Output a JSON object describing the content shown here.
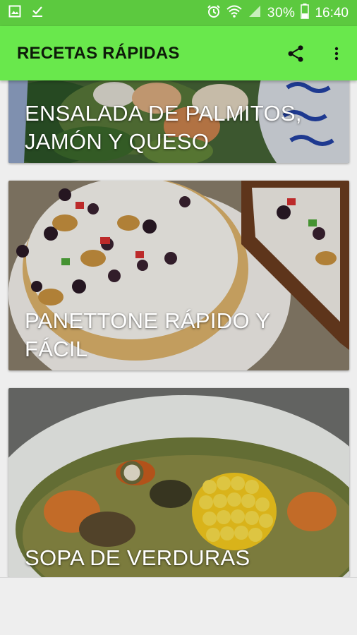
{
  "status_bar": {
    "battery_percent": "30%",
    "time": "16:40",
    "icons": [
      "image-icon",
      "download-done-icon",
      "alarm-icon",
      "wifi-icon",
      "signal-icon",
      "battery-icon"
    ]
  },
  "app_bar": {
    "title": "RECETAS RÁPIDAS",
    "actions": [
      "share-icon",
      "more-vert-icon"
    ]
  },
  "recipes": [
    {
      "title": "ENSALADA DE PALMITOS, JAMÓN Y QUESO"
    },
    {
      "title": "PANETTONE RÁPIDO Y FÁCIL"
    },
    {
      "title": "SOPA DE VERDURAS"
    }
  ],
  "colors": {
    "status_bar": "#5cc93f",
    "app_bar": "#69e84c",
    "background": "#eeeeee"
  }
}
